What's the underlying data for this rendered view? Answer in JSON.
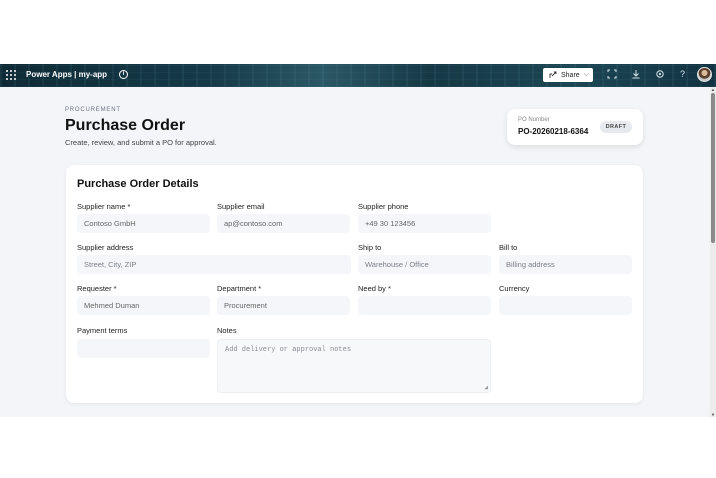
{
  "topbar": {
    "app_name": "Power Apps",
    "separator": "|",
    "app_title": "Power Apps  |  my-app",
    "share_label": "Share",
    "icons": [
      "waffle-icon",
      "info-icon",
      "share-icon",
      "chevron-down-icon",
      "fit-screen-icon",
      "download-icon",
      "settings-icon",
      "help-icon",
      "avatar"
    ]
  },
  "header": {
    "eyebrow": "PROCUREMENT",
    "title": "Purchase Order",
    "subtitle": "Create, review, and submit a PO for approval."
  },
  "po_card": {
    "label": "PO Number",
    "number": "PO-20260218-6364",
    "status": "DRAFT"
  },
  "form": {
    "title": "Purchase Order Details",
    "fields": {
      "supplier_name": {
        "label": "Supplier name *",
        "value": "Contoso GmbH"
      },
      "supplier_email": {
        "label": "Supplier email",
        "value": "ap@contoso.com"
      },
      "supplier_phone": {
        "label": "Supplier phone",
        "value": "+49 30 123456"
      },
      "supplier_address": {
        "label": "Supplier address",
        "placeholder": "Street, City, ZIP"
      },
      "ship_to": {
        "label": "Ship to",
        "placeholder": "Warehouse / Office"
      },
      "bill_to": {
        "label": "Bill to",
        "placeholder": "Billing address"
      },
      "requester": {
        "label": "Requester *",
        "value": "Mehmed Duman"
      },
      "department": {
        "label": "Department *",
        "value": "Procurement"
      },
      "need_by": {
        "label": "Need by *",
        "value": ""
      },
      "currency": {
        "label": "Currency",
        "value": ""
      },
      "payment_terms": {
        "label": "Payment terms",
        "value": ""
      },
      "notes": {
        "label": "Notes",
        "placeholder": "Add delivery or approval notes"
      }
    }
  },
  "colors": {
    "topbar": "#12313d",
    "canvas": "#f3f5f8",
    "input_bg": "#f4f6f9",
    "badge_bg": "#e6e9ee"
  }
}
